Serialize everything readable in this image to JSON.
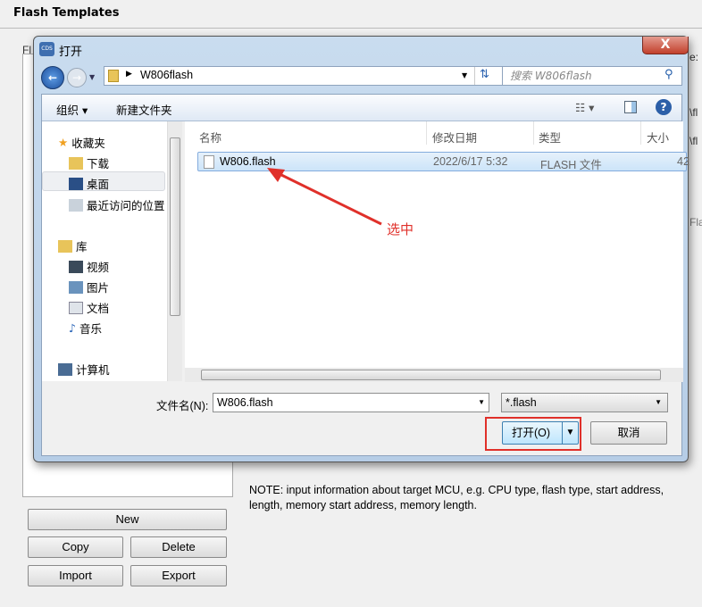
{
  "app": {
    "title": "Flash Templates",
    "list_label_fragment": "Fl",
    "right_fragments": [
      "e:",
      "\\fl",
      "\\fl",
      "Fla"
    ],
    "buttons": {
      "new": "New",
      "copy": "Copy",
      "delete": "Delete",
      "import": "Import",
      "export": "Export"
    },
    "note": "NOTE: input information about target MCU, e.g. CPU type, flash type, start address, length, memory start address, memory length."
  },
  "dialog": {
    "title": "打开",
    "app_icon_text": "CDS",
    "close_label": "X",
    "address": {
      "path": "W806flash",
      "search_placeholder": "搜索 W806flash"
    },
    "toolbar": {
      "organize": "组织 ▾",
      "new_folder": "新建文件夹"
    },
    "nav": {
      "items": [
        {
          "label": "收藏夹",
          "icon": "star-icon"
        },
        {
          "label": "下载",
          "icon": "download-folder-icon"
        },
        {
          "label": "桌面",
          "icon": "desktop-icon",
          "selected": true
        },
        {
          "label": "最近访问的位置",
          "icon": "recent-places-icon"
        },
        {
          "label": "库",
          "icon": "library-icon"
        },
        {
          "label": "视频",
          "icon": "video-icon"
        },
        {
          "label": "图片",
          "icon": "picture-icon"
        },
        {
          "label": "文档",
          "icon": "document-icon"
        },
        {
          "label": "音乐",
          "icon": "music-icon"
        },
        {
          "label": "计算机",
          "icon": "computer-icon"
        }
      ]
    },
    "columns": [
      "名称",
      "修改日期",
      "类型",
      "大小"
    ],
    "files": [
      {
        "name": "W806.flash",
        "modified": "2022/6/17 5:32",
        "type": "FLASH 文件",
        "size": "42",
        "selected": true
      }
    ],
    "annotation": "选中",
    "filename_label": "文件名(N):",
    "filename_value": "W806.flash",
    "filter_value": "*.flash",
    "open_button": "打开(O)",
    "cancel_button": "取消",
    "accent_colors": {
      "annotation": "#e0302a",
      "selection": "#cce4f9"
    }
  }
}
